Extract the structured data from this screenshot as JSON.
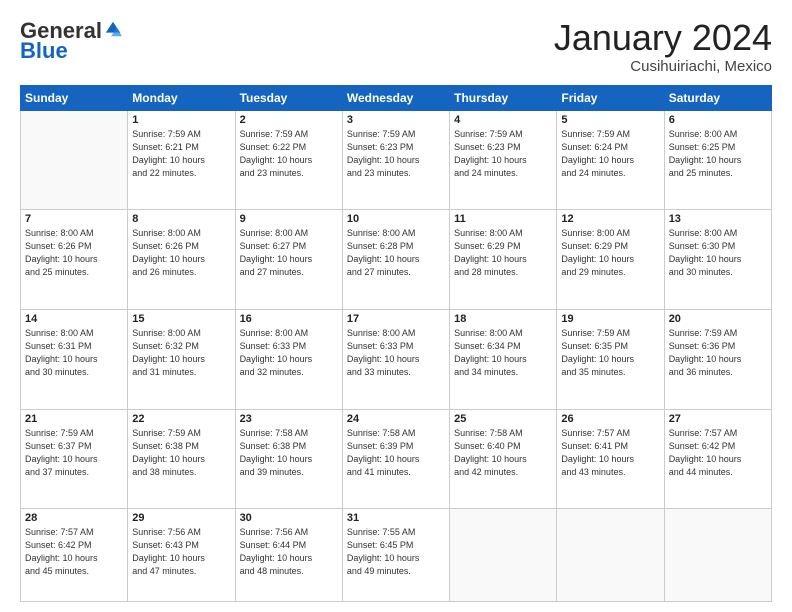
{
  "header": {
    "logo_general": "General",
    "logo_blue": "Blue",
    "month_title": "January 2024",
    "location": "Cusihuiriachi, Mexico"
  },
  "days_of_week": [
    "Sunday",
    "Monday",
    "Tuesday",
    "Wednesday",
    "Thursday",
    "Friday",
    "Saturday"
  ],
  "weeks": [
    [
      {
        "day": "",
        "info": ""
      },
      {
        "day": "1",
        "info": "Sunrise: 7:59 AM\nSunset: 6:21 PM\nDaylight: 10 hours\nand 22 minutes."
      },
      {
        "day": "2",
        "info": "Sunrise: 7:59 AM\nSunset: 6:22 PM\nDaylight: 10 hours\nand 23 minutes."
      },
      {
        "day": "3",
        "info": "Sunrise: 7:59 AM\nSunset: 6:23 PM\nDaylight: 10 hours\nand 23 minutes."
      },
      {
        "day": "4",
        "info": "Sunrise: 7:59 AM\nSunset: 6:23 PM\nDaylight: 10 hours\nand 24 minutes."
      },
      {
        "day": "5",
        "info": "Sunrise: 7:59 AM\nSunset: 6:24 PM\nDaylight: 10 hours\nand 24 minutes."
      },
      {
        "day": "6",
        "info": "Sunrise: 8:00 AM\nSunset: 6:25 PM\nDaylight: 10 hours\nand 25 minutes."
      }
    ],
    [
      {
        "day": "7",
        "info": "Sunrise: 8:00 AM\nSunset: 6:26 PM\nDaylight: 10 hours\nand 25 minutes."
      },
      {
        "day": "8",
        "info": "Sunrise: 8:00 AM\nSunset: 6:26 PM\nDaylight: 10 hours\nand 26 minutes."
      },
      {
        "day": "9",
        "info": "Sunrise: 8:00 AM\nSunset: 6:27 PM\nDaylight: 10 hours\nand 27 minutes."
      },
      {
        "day": "10",
        "info": "Sunrise: 8:00 AM\nSunset: 6:28 PM\nDaylight: 10 hours\nand 27 minutes."
      },
      {
        "day": "11",
        "info": "Sunrise: 8:00 AM\nSunset: 6:29 PM\nDaylight: 10 hours\nand 28 minutes."
      },
      {
        "day": "12",
        "info": "Sunrise: 8:00 AM\nSunset: 6:29 PM\nDaylight: 10 hours\nand 29 minutes."
      },
      {
        "day": "13",
        "info": "Sunrise: 8:00 AM\nSunset: 6:30 PM\nDaylight: 10 hours\nand 30 minutes."
      }
    ],
    [
      {
        "day": "14",
        "info": "Sunrise: 8:00 AM\nSunset: 6:31 PM\nDaylight: 10 hours\nand 30 minutes."
      },
      {
        "day": "15",
        "info": "Sunrise: 8:00 AM\nSunset: 6:32 PM\nDaylight: 10 hours\nand 31 minutes."
      },
      {
        "day": "16",
        "info": "Sunrise: 8:00 AM\nSunset: 6:33 PM\nDaylight: 10 hours\nand 32 minutes."
      },
      {
        "day": "17",
        "info": "Sunrise: 8:00 AM\nSunset: 6:33 PM\nDaylight: 10 hours\nand 33 minutes."
      },
      {
        "day": "18",
        "info": "Sunrise: 8:00 AM\nSunset: 6:34 PM\nDaylight: 10 hours\nand 34 minutes."
      },
      {
        "day": "19",
        "info": "Sunrise: 7:59 AM\nSunset: 6:35 PM\nDaylight: 10 hours\nand 35 minutes."
      },
      {
        "day": "20",
        "info": "Sunrise: 7:59 AM\nSunset: 6:36 PM\nDaylight: 10 hours\nand 36 minutes."
      }
    ],
    [
      {
        "day": "21",
        "info": "Sunrise: 7:59 AM\nSunset: 6:37 PM\nDaylight: 10 hours\nand 37 minutes."
      },
      {
        "day": "22",
        "info": "Sunrise: 7:59 AM\nSunset: 6:38 PM\nDaylight: 10 hours\nand 38 minutes."
      },
      {
        "day": "23",
        "info": "Sunrise: 7:58 AM\nSunset: 6:38 PM\nDaylight: 10 hours\nand 39 minutes."
      },
      {
        "day": "24",
        "info": "Sunrise: 7:58 AM\nSunset: 6:39 PM\nDaylight: 10 hours\nand 41 minutes."
      },
      {
        "day": "25",
        "info": "Sunrise: 7:58 AM\nSunset: 6:40 PM\nDaylight: 10 hours\nand 42 minutes."
      },
      {
        "day": "26",
        "info": "Sunrise: 7:57 AM\nSunset: 6:41 PM\nDaylight: 10 hours\nand 43 minutes."
      },
      {
        "day": "27",
        "info": "Sunrise: 7:57 AM\nSunset: 6:42 PM\nDaylight: 10 hours\nand 44 minutes."
      }
    ],
    [
      {
        "day": "28",
        "info": "Sunrise: 7:57 AM\nSunset: 6:42 PM\nDaylight: 10 hours\nand 45 minutes."
      },
      {
        "day": "29",
        "info": "Sunrise: 7:56 AM\nSunset: 6:43 PM\nDaylight: 10 hours\nand 47 minutes."
      },
      {
        "day": "30",
        "info": "Sunrise: 7:56 AM\nSunset: 6:44 PM\nDaylight: 10 hours\nand 48 minutes."
      },
      {
        "day": "31",
        "info": "Sunrise: 7:55 AM\nSunset: 6:45 PM\nDaylight: 10 hours\nand 49 minutes."
      },
      {
        "day": "",
        "info": ""
      },
      {
        "day": "",
        "info": ""
      },
      {
        "day": "",
        "info": ""
      }
    ]
  ]
}
